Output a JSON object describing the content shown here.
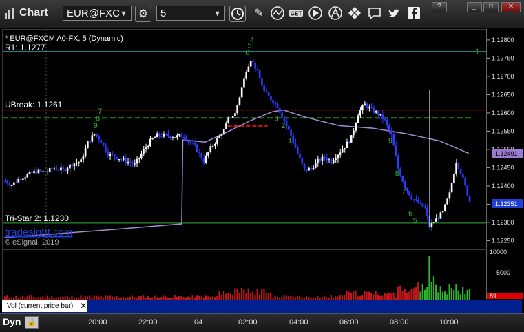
{
  "toolbar": {
    "title": "Chart",
    "symbol": "EUR@FXC",
    "interval": "5",
    "chart_icon": "chart-icon",
    "symbol_dropdown_icon": "chevron-down-icon",
    "settings_icon": "gear-icon",
    "interval_dropdown_icon": "chevron-down-icon",
    "clock_icon": "clock-icon",
    "icons": [
      "pencil-icon",
      "indicator-wave-icon",
      "get-icon",
      "play-icon",
      "alert-icon",
      "move-icon",
      "comment-icon",
      "twitter-icon",
      "facebook-icon"
    ]
  },
  "window_buttons": [
    "?",
    "_",
    "□",
    "✕"
  ],
  "chart": {
    "header": "* EUR@FXCM A0-FX, 5 (Dynamic)",
    "levels": [
      {
        "label": "R1: 1.1277",
        "value": 1.1277,
        "color": "#2aa7c0"
      },
      {
        "label": "UBreak: 1.1261",
        "value": 1.1261,
        "color": "#c01818"
      },
      {
        "label": "Tri-Star 2: 1.1230",
        "value": 1.123,
        "color": "#2a8a2a"
      }
    ],
    "green_dashed_level": 1.12588,
    "red_dashed_level": 1.12566,
    "last_price": "1.12351",
    "vwap_value": "1.12491",
    "r1_marker": "1",
    "watermark": "tradesight.com",
    "copyright": "© eSignal, 2019",
    "vol_label": "Vol (current price bar)",
    "vol_close": "✕",
    "vol_last": "89",
    "dyn": "Dyn",
    "lock_icon": "lock-icon",
    "td_labels": [
      "9",
      "8",
      "7",
      "6",
      "5",
      "4",
      "3",
      "2",
      "1"
    ]
  },
  "chart_data": {
    "type": "candlestick",
    "y_price_ticks": [
      "1.12800",
      "1.12750",
      "1.12700",
      "1.12650",
      "1.12600",
      "1.12550",
      "1.12500",
      "1.12450",
      "1.12400",
      "1.12350",
      "1.12300",
      "1.12250"
    ],
    "ylim": [
      1.1223,
      1.1283
    ],
    "x_ticks": [
      "20:00",
      "22:00",
      "04",
      "02:00",
      "04:00",
      "06:00",
      "08:00",
      "10:00"
    ],
    "vol_ticks": [
      "10000",
      "5000"
    ],
    "vol_ylim": [
      0,
      11500
    ],
    "close_path": [
      [
        0,
        1.12415
      ],
      [
        3,
        1.12405
      ],
      [
        6,
        1.1242
      ],
      [
        10,
        1.12432
      ],
      [
        14,
        1.12442
      ],
      [
        18,
        1.1244
      ],
      [
        22,
        1.1245
      ],
      [
        26,
        1.12445
      ],
      [
        30,
        1.12462
      ],
      [
        34,
        1.1247
      ],
      [
        37,
        1.1252
      ],
      [
        40,
        1.12545
      ],
      [
        43,
        1.12525
      ],
      [
        46,
        1.1249
      ],
      [
        50,
        1.1248
      ],
      [
        54,
        1.1247
      ],
      [
        58,
        1.1246
      ],
      [
        61,
        1.1249
      ],
      [
        65,
        1.12525
      ],
      [
        68,
        1.1254
      ],
      [
        72,
        1.1254
      ],
      [
        76,
        1.12537
      ],
      [
        80,
        1.1254
      ],
      [
        82,
        1.12525
      ],
      [
        85,
        1.1251
      ],
      [
        87,
        1.1249
      ],
      [
        89,
        1.1247
      ],
      [
        92,
        1.12505
      ],
      [
        95,
        1.1253
      ],
      [
        98,
        1.12555
      ],
      [
        100,
        1.12585
      ],
      [
        103,
        1.126
      ],
      [
        106,
        1.1267
      ],
      [
        108,
        1.1272
      ],
      [
        110,
        1.1275
      ],
      [
        113,
        1.12715
      ],
      [
        116,
        1.1266
      ],
      [
        119,
        1.1264
      ],
      [
        122,
        1.1262
      ],
      [
        125,
        1.1258
      ],
      [
        128,
        1.1254
      ],
      [
        131,
        1.1249
      ],
      [
        134,
        1.12445
      ],
      [
        137,
        1.1245
      ],
      [
        140,
        1.1247
      ],
      [
        143,
        1.1248
      ],
      [
        146,
        1.1247
      ],
      [
        149,
        1.1249
      ],
      [
        152,
        1.1251
      ],
      [
        155,
        1.12535
      ],
      [
        158,
        1.126
      ],
      [
        161,
        1.12625
      ],
      [
        164,
        1.1261
      ],
      [
        167,
        1.126
      ],
      [
        170,
        1.1258
      ],
      [
        173,
        1.1254
      ],
      [
        176,
        1.1245
      ],
      [
        179,
        1.124
      ],
      [
        182,
        1.1237
      ],
      [
        185,
        1.12355
      ],
      [
        188,
        1.1234
      ],
      [
        190,
        1.1229
      ],
      [
        193,
        1.1231
      ],
      [
        196,
        1.1233
      ],
      [
        199,
        1.1238
      ],
      [
        202,
        1.1247
      ],
      [
        204,
        1.1244
      ],
      [
        206,
        1.124
      ],
      [
        208,
        1.1236
      ]
    ],
    "vwap": [
      [
        0,
        1.1226
      ],
      [
        50,
        1.12283
      ],
      [
        79.5,
        1.12298
      ],
      [
        80,
        1.12528
      ],
      [
        90,
        1.12522
      ],
      [
        100,
        1.1255
      ],
      [
        110,
        1.1258
      ],
      [
        120,
        1.12605
      ],
      [
        125,
        1.1261
      ],
      [
        135,
        1.1259
      ],
      [
        150,
        1.12567
      ],
      [
        165,
        1.1256
      ],
      [
        180,
        1.12545
      ],
      [
        195,
        1.12525
      ],
      [
        208,
        1.12491
      ]
    ],
    "spike": {
      "bar": 190,
      "high": 1.12665,
      "low": 1.1229
    }
  }
}
